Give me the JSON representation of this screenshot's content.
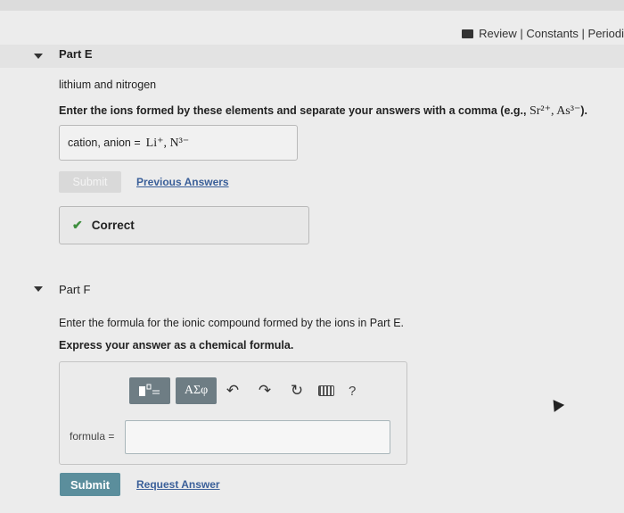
{
  "top_links": "Review | Constants | Periodi",
  "part_e": {
    "title": "Part E",
    "prompt": "lithium and nitrogen",
    "instruction_prefix": "Enter the ions formed by these elements and separate your answers with a comma (e.g., ",
    "instruction_example": "Sr²⁺, As³⁻",
    "instruction_suffix": ").",
    "answer_label": "cation, anion =",
    "answer_value": "Li⁺, N³⁻",
    "submit_label": "Submit",
    "previous_answers_label": "Previous Answers",
    "feedback": "Correct"
  },
  "part_f": {
    "title": "Part F",
    "prompt": "Enter the formula for the ionic compound formed by the ions in Part E.",
    "instruction": "Express your answer as a chemical formula.",
    "toolbar": {
      "greek_label": "ΑΣφ",
      "help_label": "?",
      "template_icon": "template-icon",
      "undo_icon": "undo-icon",
      "redo_icon": "redo-icon",
      "reset_icon": "reset-icon",
      "keyboard_icon": "keyboard-icon"
    },
    "formula_label": "formula =",
    "formula_value": "",
    "submit_label": "Submit",
    "request_answer_label": "Request Answer"
  },
  "colors": {
    "submit": "#5b8e9c",
    "link": "#3a5f99",
    "correct": "#3e8e3e",
    "toolbar_button": "#6e7d84"
  }
}
